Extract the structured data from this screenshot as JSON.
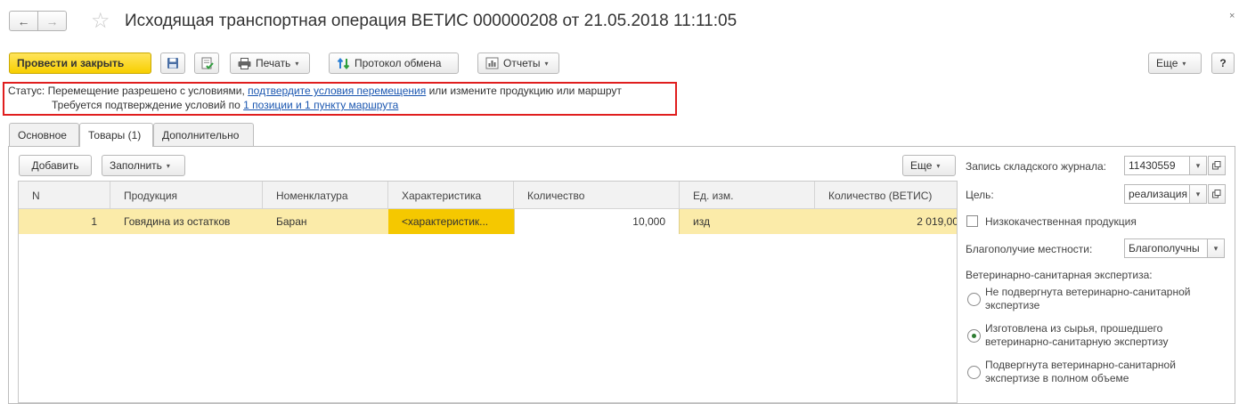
{
  "window": {
    "title": "Исходящая транспортная операция ВЕТИС 000000208 от 21.05.2018 11:11:05",
    "close_glyph": "×"
  },
  "toolbar": {
    "post_close_label": "Провести и закрыть",
    "print_label": "Печать",
    "protocol_label": "Протокол обмена",
    "reports_label": "Отчеты",
    "more_label": "Еще",
    "help_label": "?"
  },
  "status": {
    "prefix": "Статус:",
    "line1_text": "Перемещение разрешено с условиями,",
    "line1_link": "подтвердите условия перемещения",
    "line1_suffix": "или измените продукцию или маршрут",
    "line2_text": "Требуется подтверждение условий по",
    "line2_link": "1 позиции и 1 пункту маршрута"
  },
  "tabs": [
    {
      "label": "Основное"
    },
    {
      "label": "Товары (1)"
    },
    {
      "label": "Дополнительно"
    }
  ],
  "goods": {
    "add_label": "Добавить",
    "fill_label": "Заполнить",
    "more_label": "Еще",
    "columns": [
      "N",
      "Продукция",
      "Номенклатура",
      "Характеристика",
      "Количество",
      "Ед. изм.",
      "Количество (ВЕТИС)"
    ],
    "rows": [
      {
        "n": "1",
        "product": "Говядина из остатков",
        "nomenclature": "Баран",
        "characteristic": "<характеристик...",
        "quantity": "10,000",
        "unit": "изд",
        "qty_vetis": "2 019,00"
      }
    ]
  },
  "side": {
    "journal_label": "Запись складского журнала:",
    "journal_value": "11430559",
    "purpose_label": "Цель:",
    "purpose_value": "реализация",
    "low_quality_label": "Низкокачественная продукция",
    "wellbeing_label": "Благополучие местности:",
    "wellbeing_value": "Благополучны",
    "expertise_label": "Ветеринарно-санитарная экспертиза:",
    "options": [
      {
        "line1": "Не подвергнута ветеринарно-санитарной",
        "line2": "экспертизе",
        "selected": false
      },
      {
        "line1": "Изготовлена из сырья, прошедшего",
        "line2": "ветеринарно-санитарную экспертизу",
        "selected": true
      },
      {
        "line1": "Подвергнута ветеринарно-санитарной",
        "line2": "экспертизе в полном объеме",
        "selected": false
      }
    ]
  },
  "icons": {
    "back": "←",
    "forward": "→",
    "star": "☆",
    "dropdown": "▾"
  }
}
